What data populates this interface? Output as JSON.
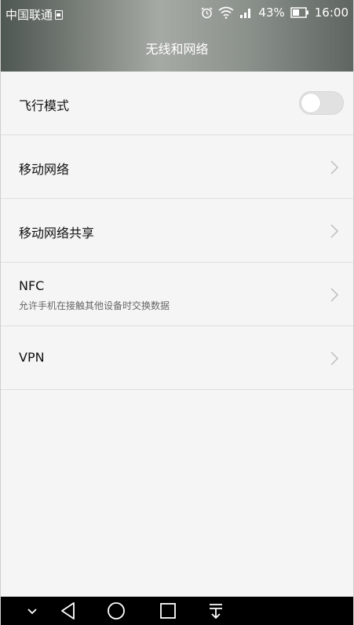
{
  "status_bar": {
    "carrier": "中国联通",
    "battery_percent": "43%",
    "time": "16:00",
    "icons": [
      "sim-icon",
      "alarm-icon",
      "wifi-icon",
      "signal-icon",
      "battery-icon"
    ]
  },
  "header": {
    "title": "无线和网络"
  },
  "settings": {
    "items": [
      {
        "label": "飞行模式",
        "control": "toggle",
        "enabled": false
      },
      {
        "label": "移动网络",
        "control": "chevron"
      },
      {
        "label": "移动网络共享",
        "control": "chevron"
      },
      {
        "label": "NFC",
        "sublabel": "允许手机在接触其他设备时交换数据",
        "control": "chevron"
      },
      {
        "label": "VPN",
        "control": "chevron"
      }
    ]
  },
  "nav_bar": {
    "buttons": [
      "hide-nav-icon",
      "back-icon",
      "home-icon",
      "recents-icon",
      "notifications-icon"
    ]
  },
  "colors": {
    "header_gradient": [
      "#4f5752",
      "#a6aaa4",
      "#5f6560"
    ],
    "background": "#f5f5f5",
    "toggle_off": "#e1e1e1",
    "nav_bar": "#000000"
  }
}
